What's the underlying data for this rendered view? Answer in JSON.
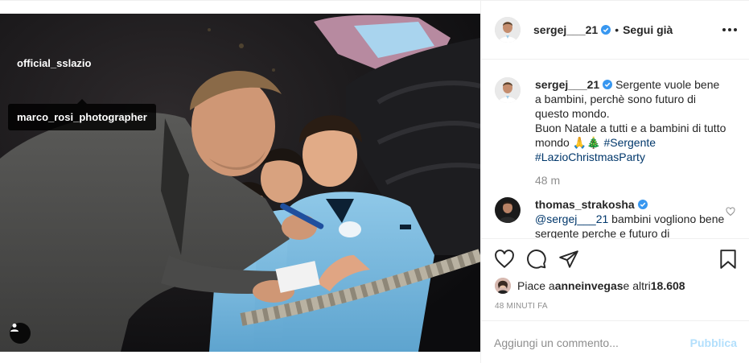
{
  "photo": {
    "tags": [
      "official_sslazio",
      "marco_rosi_photographer"
    ],
    "user_tag_icon": "person-icon"
  },
  "header": {
    "username": "sergej___21",
    "separator": "•",
    "follow_label": "Segui già",
    "more_icon": "ellipsis-icon"
  },
  "caption": {
    "username": "sergej___21",
    "text_line1": "Sergente vuole bene a bambini, perchè sono futuro di questo mondo.",
    "text_line2": "Buon Natale a tutti e a bambini di tutto mondo 🙏🎄 ",
    "hashtag1": "#Sergente",
    "hashtag2": "#LazioChristmasParty",
    "time": "48 m"
  },
  "comment2": {
    "username": "thomas_strakosha",
    "mention": "@sergej___21",
    "text": " bambini vogliono bene sergente perche e futuro di"
  },
  "likes": {
    "prefix": "Piace a ",
    "user": "anneinvegas",
    "middle": " e altri ",
    "count": "18.608"
  },
  "time_ago": "48 MINUTI FA",
  "add_comment": {
    "placeholder": "Aggiungi un commento...",
    "publish_label": "Pubblica"
  },
  "colors": {
    "verified": "#3897f0",
    "hashtag": "#00376b",
    "publish": "#b2dffc",
    "muted": "#8e8e8e"
  }
}
